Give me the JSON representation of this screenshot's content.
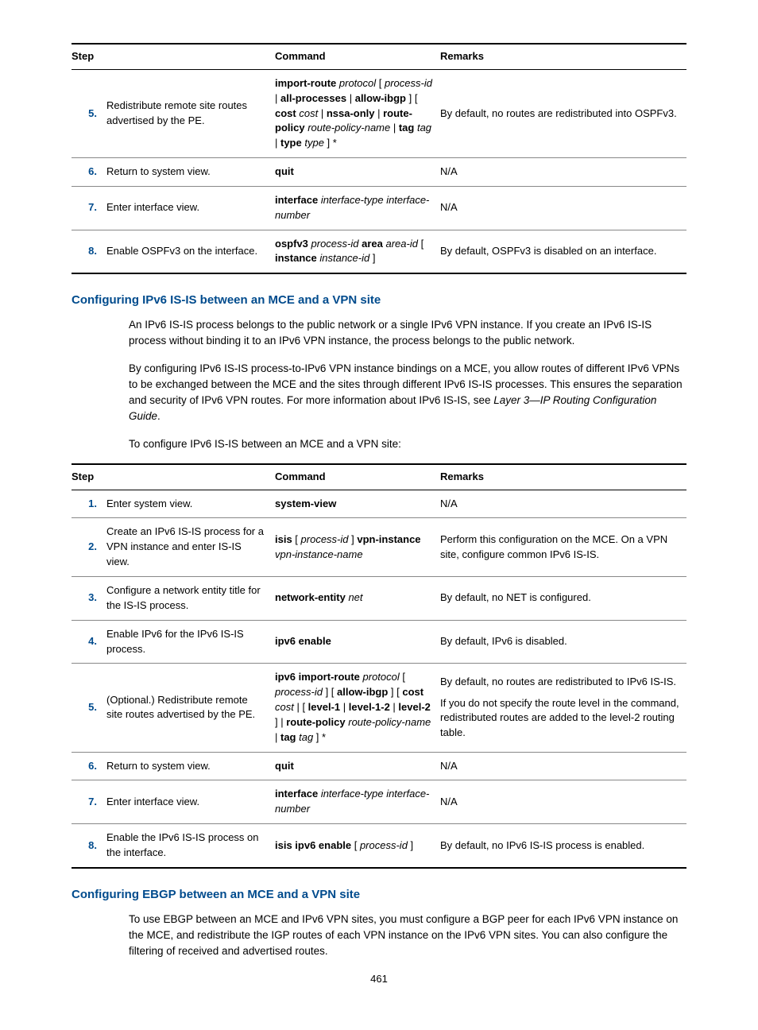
{
  "table1": {
    "headers": {
      "step": "Step",
      "command": "Command",
      "remarks": "Remarks"
    },
    "rows": [
      {
        "num": "5.",
        "name": "Redistribute remote site routes advertised by the PE.",
        "cmd_parts": [
          "import-route",
          " protocol ",
          "[ ",
          "process-id",
          " | ",
          "all-processes",
          " | ",
          "allow-ibgp",
          " ] [ ",
          "cost",
          " cost",
          " | ",
          "nssa-only",
          " | ",
          "route-policy",
          " route-policy-name",
          " | ",
          "tag",
          " tag",
          " | ",
          "type",
          " type",
          " ] *"
        ],
        "cmd_bold": [
          true,
          false,
          false,
          false,
          false,
          true,
          false,
          true,
          false,
          true,
          false,
          false,
          true,
          false,
          true,
          false,
          false,
          true,
          false,
          false,
          true,
          false,
          false
        ],
        "cmd_ital": [
          false,
          true,
          false,
          true,
          false,
          false,
          false,
          false,
          false,
          false,
          true,
          false,
          false,
          false,
          false,
          true,
          false,
          false,
          true,
          false,
          false,
          true,
          false
        ],
        "remarks": "By default, no routes are redistributed into OSPFv3."
      },
      {
        "num": "6.",
        "name": "Return to system view.",
        "cmd_parts": [
          "quit"
        ],
        "cmd_bold": [
          true
        ],
        "cmd_ital": [
          false
        ],
        "remarks": "N/A"
      },
      {
        "num": "7.",
        "name": "Enter interface view.",
        "cmd_parts": [
          "interface",
          " interface-type interface-number"
        ],
        "cmd_bold": [
          true,
          false
        ],
        "cmd_ital": [
          false,
          true
        ],
        "remarks": "N/A"
      },
      {
        "num": "8.",
        "name": "Enable OSPFv3 on the interface.",
        "cmd_parts": [
          "ospfv3",
          " process-id ",
          "area",
          " area-id ",
          "[ ",
          "instance",
          " instance-id",
          " ]"
        ],
        "cmd_bold": [
          true,
          false,
          true,
          false,
          false,
          true,
          false,
          false
        ],
        "cmd_ital": [
          false,
          true,
          false,
          true,
          false,
          false,
          true,
          false
        ],
        "remarks": "By default, OSPFv3 is disabled on an interface."
      }
    ]
  },
  "section1": {
    "title": "Configuring IPv6 IS-IS between an MCE and a VPN site",
    "para1": "An IPv6 IS-IS process belongs to the public network or a single IPv6 VPN instance. If you create an IPv6 IS-IS process without binding it to an IPv6 VPN instance, the process belongs to the public network.",
    "para2_a": "By configuring IPv6 IS-IS process-to-IPv6 VPN instance bindings on a MCE, you allow routes of different IPv6 VPNs to be exchanged between the MCE and the sites through different IPv6 IS-IS processes. This ensures the separation and security of IPv6 VPN routes. For more information about IPv6 IS-IS, see ",
    "para2_b": "Layer 3—IP Routing Configuration Guide",
    "para2_c": ".",
    "para3": "To configure IPv6 IS-IS between an MCE and a VPN site:"
  },
  "table2": {
    "headers": {
      "step": "Step",
      "command": "Command",
      "remarks": "Remarks"
    },
    "rows": [
      {
        "num": "1.",
        "name": "Enter system view.",
        "cmd_parts": [
          "system-view"
        ],
        "cmd_bold": [
          true
        ],
        "cmd_ital": [
          false
        ],
        "remarks": "N/A"
      },
      {
        "num": "2.",
        "name": "Create an IPv6 IS-IS process for a VPN instance and enter IS-IS view.",
        "cmd_parts": [
          "isis",
          " [ ",
          "process-id",
          " ] ",
          "vpn-instance",
          " vpn-instance-name"
        ],
        "cmd_bold": [
          true,
          false,
          false,
          false,
          true,
          false
        ],
        "cmd_ital": [
          false,
          false,
          true,
          false,
          false,
          true
        ],
        "remarks": "Perform this configuration on the MCE. On a VPN site, configure common IPv6 IS-IS."
      },
      {
        "num": "3.",
        "name": "Configure a network entity title for the IS-IS process.",
        "cmd_parts": [
          "network-entity",
          " net"
        ],
        "cmd_bold": [
          true,
          false
        ],
        "cmd_ital": [
          false,
          true
        ],
        "remarks": "By default, no NET is configured."
      },
      {
        "num": "4.",
        "name": "Enable IPv6 for the IPv6 IS-IS process.",
        "cmd_parts": [
          "ipv6 enable"
        ],
        "cmd_bold": [
          true
        ],
        "cmd_ital": [
          false
        ],
        "remarks": "By default, IPv6 is disabled."
      },
      {
        "num": "5.",
        "name": "(Optional.) Redistribute remote site routes advertised by the PE.",
        "cmd_parts": [
          "ipv6 import-route",
          " protocol ",
          "[ ",
          "process-id",
          " ] [ ",
          "allow-ibgp",
          " ] [ ",
          "cost",
          " cost",
          " | [ ",
          "level-1",
          " | ",
          "level-1-2",
          " | ",
          "level-2",
          " ] | ",
          "route-policy",
          " route-policy-name",
          " | ",
          "tag",
          " tag",
          " ] *"
        ],
        "cmd_bold": [
          true,
          false,
          false,
          false,
          false,
          true,
          false,
          true,
          false,
          false,
          true,
          false,
          true,
          false,
          true,
          false,
          true,
          false,
          false,
          true,
          false,
          false
        ],
        "cmd_ital": [
          false,
          true,
          false,
          true,
          false,
          false,
          false,
          false,
          true,
          false,
          false,
          false,
          false,
          false,
          false,
          false,
          false,
          true,
          false,
          false,
          true,
          false
        ],
        "remarks_multi": [
          "By default, no routes are redistributed to IPv6 IS-IS.",
          "If you do not specify the route level in the command, redistributed routes are added to the level-2 routing table."
        ]
      },
      {
        "num": "6.",
        "name": "Return to system view.",
        "cmd_parts": [
          "quit"
        ],
        "cmd_bold": [
          true
        ],
        "cmd_ital": [
          false
        ],
        "remarks": "N/A"
      },
      {
        "num": "7.",
        "name": "Enter interface view.",
        "cmd_parts": [
          "interface",
          " interface-type interface-number"
        ],
        "cmd_bold": [
          true,
          false
        ],
        "cmd_ital": [
          false,
          true
        ],
        "remarks": "N/A"
      },
      {
        "num": "8.",
        "name": "Enable the IPv6 IS-IS process on the interface.",
        "cmd_parts": [
          "isis ipv6 enable",
          " [ ",
          "process-id",
          " ]"
        ],
        "cmd_bold": [
          true,
          false,
          false,
          false
        ],
        "cmd_ital": [
          false,
          false,
          true,
          false
        ],
        "remarks": "By default, no IPv6 IS-IS process is enabled."
      }
    ]
  },
  "section2": {
    "title": "Configuring EBGP between an MCE and a VPN site",
    "para1": "To use EBGP between an MCE and IPv6 VPN sites, you must configure a BGP peer for each IPv6 VPN instance on the MCE, and redistribute the IGP routes of each VPN instance on the IPv6 VPN sites. You can also configure the filtering of received and advertised routes."
  },
  "page_number": "461"
}
